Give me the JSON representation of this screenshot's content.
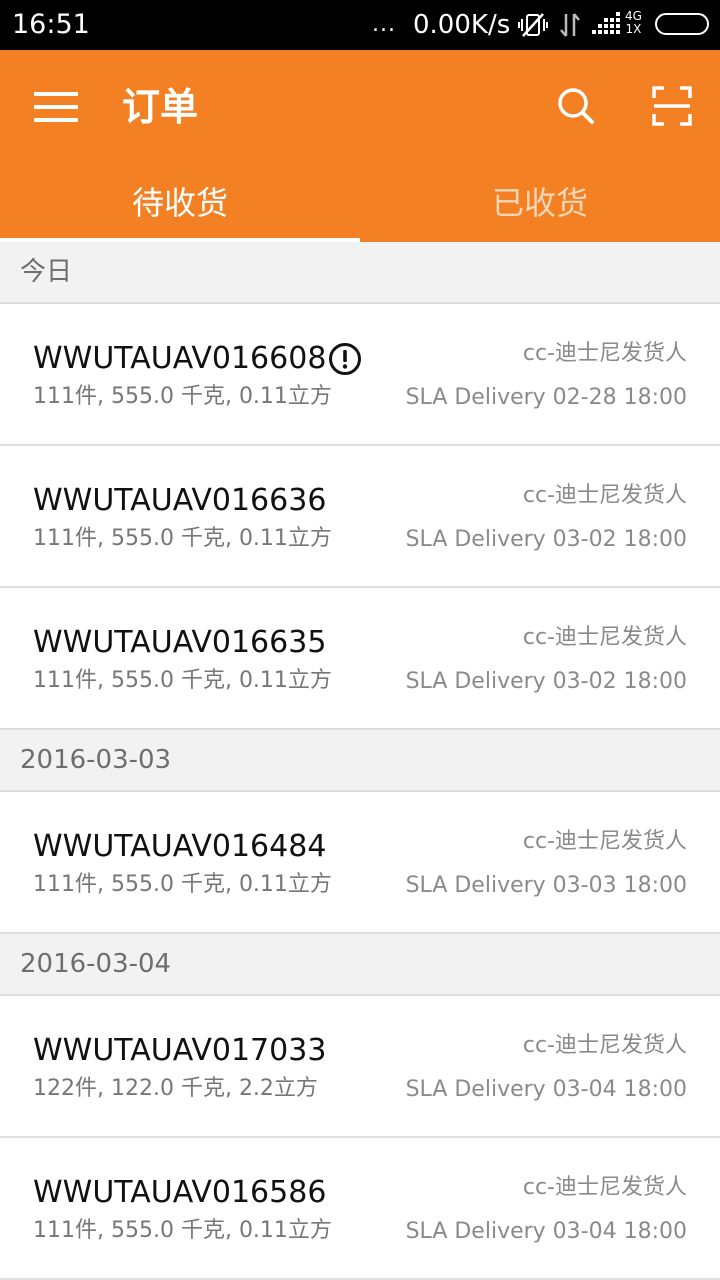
{
  "status_bar": {
    "time": "16:51",
    "dots": "...",
    "speed": "0.00K/s",
    "network_top": "4G",
    "network_bottom": "1X",
    "icons": [
      "vibrate-off-icon",
      "data-transfer-icon",
      "signal-icon",
      "battery-icon"
    ]
  },
  "app_bar": {
    "menu_icon": "hamburger-menu-icon",
    "title": "订单",
    "search_icon": "search-icon",
    "scan_icon": "scan-icon",
    "accent_color": "#f38124"
  },
  "tabs": [
    {
      "label": "待收货",
      "selected": true
    },
    {
      "label": "已收货",
      "selected": false
    }
  ],
  "sections": [
    {
      "header": "今日",
      "orders": [
        {
          "id": "WWUTAUAV016608",
          "has_alert": true,
          "meta": "111件, 555.0 千克, 0.11立方",
          "shipper": "cc-迪士尼发货人",
          "sla": "SLA Delivery 02-28 18:00"
        },
        {
          "id": "WWUTAUAV016636",
          "has_alert": false,
          "meta": "111件, 555.0 千克, 0.11立方",
          "shipper": "cc-迪士尼发货人",
          "sla": "SLA Delivery 03-02 18:00"
        },
        {
          "id": "WWUTAUAV016635",
          "has_alert": false,
          "meta": "111件, 555.0 千克, 0.11立方",
          "shipper": "cc-迪士尼发货人",
          "sla": "SLA Delivery 03-02 18:00"
        }
      ]
    },
    {
      "header": "2016-03-03",
      "orders": [
        {
          "id": "WWUTAUAV016484",
          "has_alert": false,
          "meta": "111件, 555.0 千克, 0.11立方",
          "shipper": "cc-迪士尼发货人",
          "sla": "SLA Delivery 03-03 18:00"
        }
      ]
    },
    {
      "header": "2016-03-04",
      "orders": [
        {
          "id": "WWUTAUAV017033",
          "has_alert": false,
          "meta": "122件, 122.0 千克, 2.2立方",
          "shipper": "cc-迪士尼发货人",
          "sla": "SLA Delivery 03-04 18:00"
        },
        {
          "id": "WWUTAUAV016586",
          "has_alert": false,
          "meta": "111件, 555.0 千克, 0.11立方",
          "shipper": "cc-迪士尼发货人",
          "sla": "SLA Delivery 03-04 18:00"
        }
      ]
    }
  ]
}
